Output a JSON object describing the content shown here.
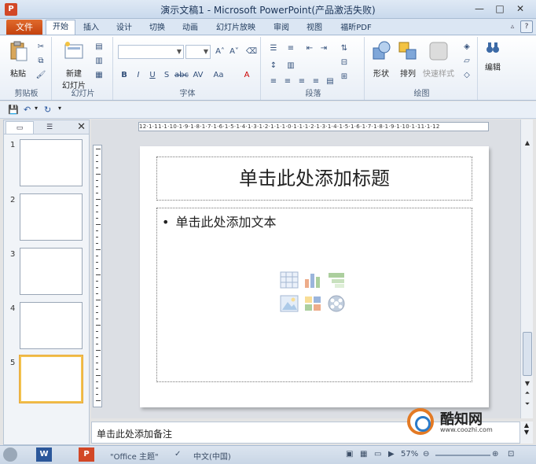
{
  "window": {
    "title": "演示文稿1 - Microsoft PowerPoint(产品激活失败)",
    "app_letter": "P",
    "minimize": "—",
    "maximize": "□",
    "close": "✕"
  },
  "ribbon_tabs": [
    {
      "label": "文件"
    },
    {
      "label": "开始"
    },
    {
      "label": "插入"
    },
    {
      "label": "设计"
    },
    {
      "label": "切换"
    },
    {
      "label": "动画"
    },
    {
      "label": "幻灯片放映"
    },
    {
      "label": "审阅"
    },
    {
      "label": "视图"
    },
    {
      "label": "福昕PDF"
    }
  ],
  "ribbon": {
    "clipboard": {
      "label": "剪贴板",
      "paste": "粘贴"
    },
    "slides": {
      "label": "幻灯片",
      "new_slide_line1": "新建",
      "new_slide_line2": "幻灯片"
    },
    "font": {
      "label": "字体"
    },
    "paragraph": {
      "label": "段落"
    },
    "drawing": {
      "label": "绘图",
      "shape": "形状",
      "arrange": "排列",
      "quick_styles": "快速样式"
    },
    "editing": {
      "label": "编辑"
    }
  },
  "slide_pane": {
    "numbers": [
      "1",
      "2",
      "3",
      "4",
      "5"
    ],
    "selected": 5
  },
  "horizontal_ruler": "12·1·11·1·10·1·9·1·8·1·7·1·6·1·5·1·4·1·3·1·2·1·1·1·0·1·1·1·2·1·3·1·4·1·5·1·6·1·7·1·8·1·9·1·10·1·11·1·12",
  "slide": {
    "title_placeholder": "单击此处添加标题",
    "body_placeholder": "单击此处添加文本",
    "bullet": "•"
  },
  "notes": {
    "placeholder": "单击此处添加备注"
  },
  "status_bar": {
    "theme": "\"Office 主题\"",
    "language": "中文(中国)",
    "zoom": "57%"
  },
  "watermark": {
    "name": "酷知网",
    "url": "www.coozhi.com"
  }
}
